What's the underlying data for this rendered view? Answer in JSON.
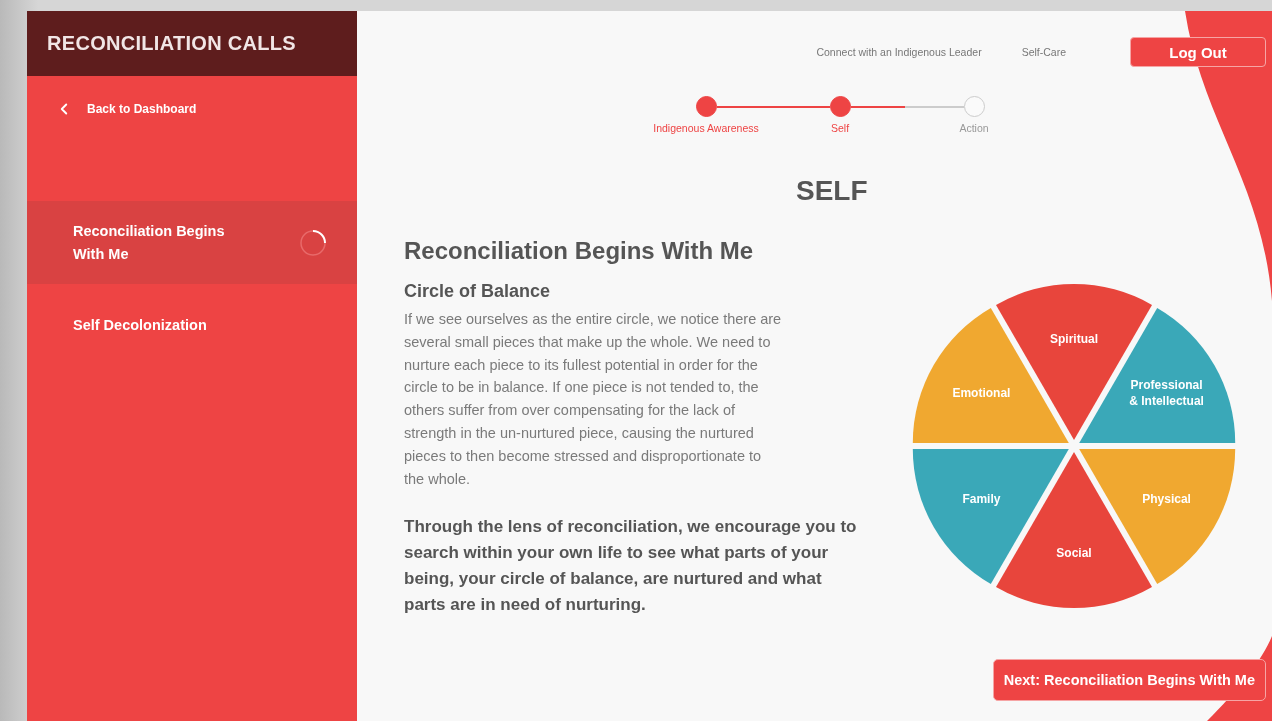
{
  "sidebar": {
    "title": "RECONCILIATION CALLS",
    "back_link": "Back to Dashboard",
    "items": [
      {
        "label": "Reconciliation Begins With Me",
        "selected": true,
        "loading": true
      },
      {
        "label": "Self Decolonization",
        "selected": false,
        "loading": false
      }
    ]
  },
  "top_nav": {
    "links": [
      "Connect with an Indigenous Leader",
      "Self-Care"
    ],
    "logout_button": "Log Out"
  },
  "stepper": {
    "connectors": [
      {
        "level": 1
      },
      {
        "level": 0.48
      }
    ],
    "steps": [
      {
        "label": "Indigenous Awareness",
        "completed": true
      },
      {
        "label": "Self",
        "completed": true
      },
      {
        "label": "Action",
        "completed": false
      }
    ]
  },
  "page_title": "SELF",
  "section_title": "Reconciliation Begins With Me",
  "subsection_title": "Circle of Balance",
  "paragraphs": [
    "If we see ourselves as the entire circle, we notice there are several small pieces that make up the whole. We need to nurture each piece to its fullest potential in order for the circle to be in balance. If one piece is not tended to, the others suffer from over compensating for the lack of strength in the un-nurtured piece, causing the nurtured pieces to then become stressed and disproportionate to the whole.",
    "Through the lens of reconciliation, we encourage you to search within your own life to see what parts of your being, your circle of balance, are nurtured and what parts are in need of nurturing."
  ],
  "wheel": {
    "segments": [
      {
        "label_lines": [
          "Spiritual"
        ],
        "color": "#e8453c"
      },
      {
        "label_lines": [
          "Professional",
          "& Intellectual"
        ],
        "color": "#3aa8b8"
      },
      {
        "label_lines": [
          "Physical"
        ],
        "color": "#f0a830"
      },
      {
        "label_lines": [
          "Social"
        ],
        "color": "#e8453c"
      },
      {
        "label_lines": [
          "Family"
        ],
        "color": "#3aa8b8"
      },
      {
        "label_lines": [
          "Emotional"
        ],
        "color": "#f0a830"
      }
    ]
  },
  "next_button": "Next: Reconciliation Begins With Me"
}
